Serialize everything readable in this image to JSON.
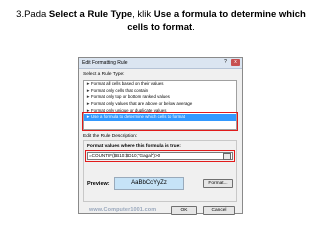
{
  "caption": {
    "prefix": "3.Pada ",
    "bold1": "Select a Rule Type",
    "mid": ", klik ",
    "bold2": "Use a formula to determine which cells to format",
    "suffix": "."
  },
  "dialog": {
    "title": "Edit Formatting Rule",
    "help_label": "?",
    "close_label": "x",
    "select_rule_type_label": "Select a Rule Type:",
    "rule_types": [
      "Format all cells based on their values",
      "Format only cells that contain",
      "Format only top or bottom ranked values",
      "Format only values that are above or below average",
      "Format only unique or duplicate values",
      "Use a formula to determine which cells to format"
    ],
    "selected_index": 5,
    "rule_arrow": "►",
    "edit_description_label": "Edit the Rule Description:",
    "formula_label": "Format values where this formula is true:",
    "formula_value": "=COUNTIF($B10:$D10;\"Gagal\")>0",
    "preview_label": "Preview:",
    "preview_text": "AaBbCcYyZz",
    "format_button": "Format...",
    "ok_button": "OK",
    "cancel_button": "Cancel",
    "watermark": "www.Computer1001.com"
  }
}
